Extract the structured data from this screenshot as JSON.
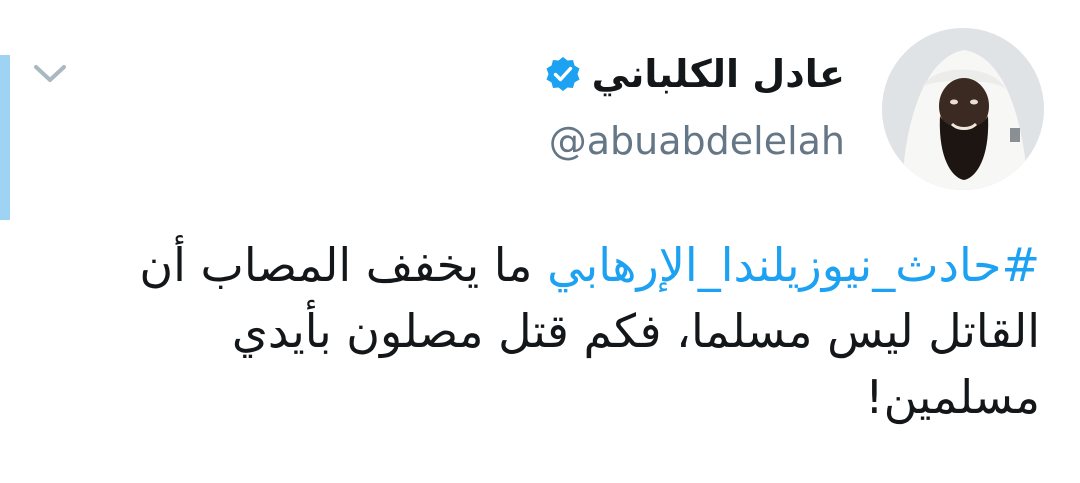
{
  "author": {
    "display_name": "عادل الكلباني",
    "handle": "@abuabdelelah",
    "verified": true
  },
  "tweet": {
    "hashtag": "#حادث_نيوزيلندا_الإرهابي",
    "text_rest": " ما يخفف المصاب أن القاتل ليس مسلما، فكم قتل مصلون بأيدي مسلمين!"
  },
  "colors": {
    "link": "#1da1f2",
    "verified_badge": "#1da1f2",
    "thread_bar": "#9fd3f3",
    "handle": "#657786",
    "text": "#14171a"
  },
  "icons": {
    "caret": "chevron-down-icon",
    "verified": "verified-badge-icon"
  }
}
